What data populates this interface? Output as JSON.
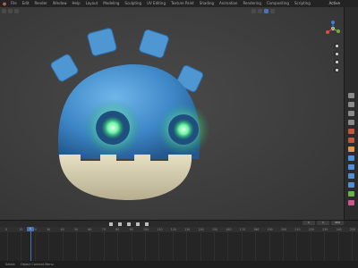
{
  "app": {
    "menus": [
      "File",
      "Edit",
      "Render",
      "Window",
      "Help",
      "Layout",
      "Modeling",
      "Sculpting",
      "UV Editing",
      "Texture Paint",
      "Shading",
      "Animation",
      "Rendering",
      "Compositing",
      "Scripting"
    ],
    "scene_label": "Active"
  },
  "icons": {
    "logo": "blender-logo-icon",
    "play": "play-icon",
    "camera": "camera-icon",
    "hand": "pan-hand-icon",
    "zoom": "zoom-icon"
  },
  "colors": {
    "viewport_bg": "#3c3c3c",
    "body_blue": "#3d86c6",
    "jaw": "#d8d1b4",
    "eye_glow": "#38f088",
    "accent": "#4772b3"
  },
  "timeline": {
    "ticks": [
      "0",
      "10",
      "20",
      "30",
      "40",
      "50",
      "60",
      "70",
      "80",
      "90",
      "100",
      "110",
      "120",
      "130",
      "140",
      "150",
      "160",
      "170",
      "180",
      "190",
      "200",
      "210",
      "220",
      "230",
      "240",
      "250"
    ],
    "current_frame": "1",
    "start": "1",
    "end": "250"
  },
  "statusbar": {
    "left": "Select",
    "middle": "Object Context Menu"
  }
}
